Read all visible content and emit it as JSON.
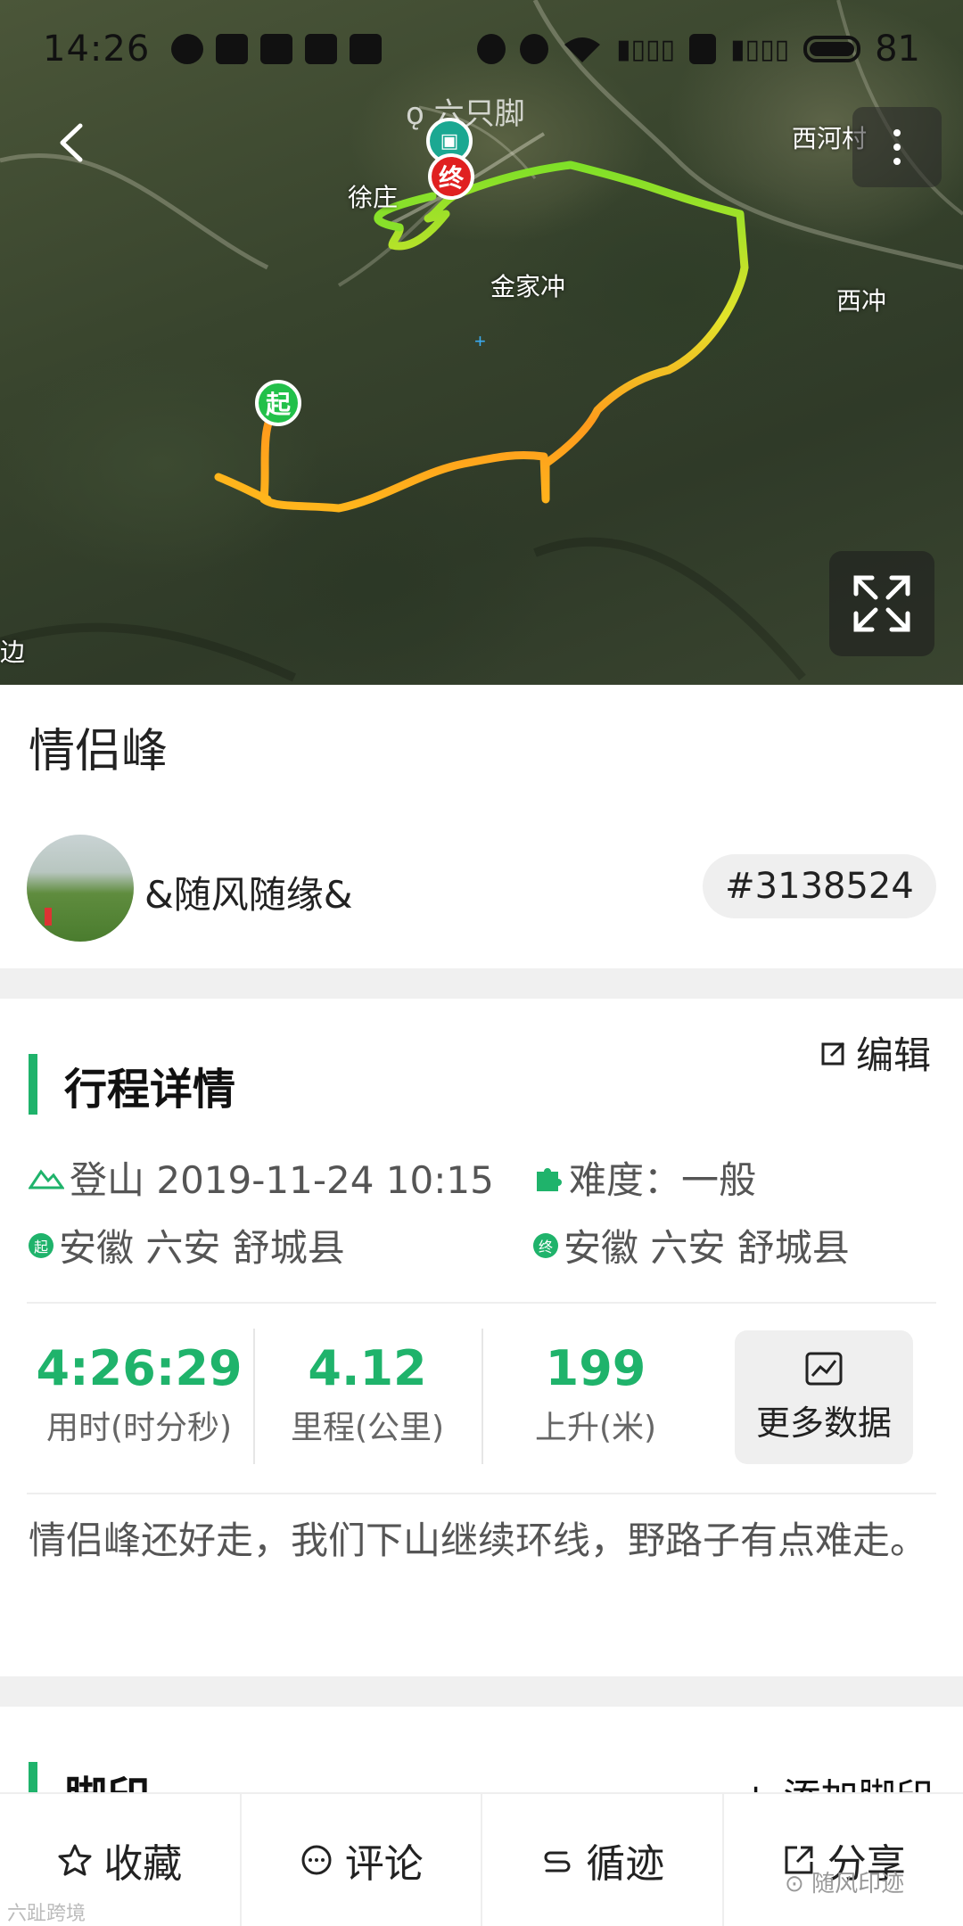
{
  "status_bar": {
    "time": "14:26",
    "battery": "81"
  },
  "map": {
    "watermark": "六只脚",
    "places": [
      "徐庄",
      "西河村",
      "金家冲",
      "西冲",
      "边"
    ],
    "start_pin": "起",
    "end_pin": "终",
    "icons": {
      "back": "back-arrow-icon",
      "more": "more-vertical-icon",
      "expand": "expand-icon",
      "photo": "photo-icon"
    }
  },
  "trip": {
    "title": "情侣峰",
    "author": "&随风随缘&",
    "id_tag": "#3138524"
  },
  "details": {
    "section_title": "行程详情",
    "edit_label": "编辑",
    "activity": "登山 2019-11-24 10:15",
    "difficulty": "难度：一般",
    "start_badge": "起",
    "start_location": "安徽 六安 舒城县",
    "end_badge": "终",
    "end_location": "安徽 六安 舒城县",
    "stats": [
      {
        "value": "4:26:29",
        "label": "用时(时分秒)"
      },
      {
        "value": "4.12",
        "label": "里程(公里)"
      },
      {
        "value": "199",
        "label": "上升(米)"
      }
    ],
    "more_data_label": "更多数据",
    "description": "情侣峰还好走，我们下山继续环线，野路子有点难走。"
  },
  "footprints": {
    "section_title": "脚印",
    "add_label": "+ 添加脚印"
  },
  "tabbar": [
    {
      "label": "收藏",
      "icon": "star-icon"
    },
    {
      "label": "评论",
      "icon": "comment-icon"
    },
    {
      "label": "循迹",
      "icon": "follow-track-icon"
    },
    {
      "label": "分享",
      "icon": "share-icon"
    }
  ],
  "watermarks": {
    "bottom_right": "随风印迹",
    "bottom_left": "六趾跨境"
  },
  "colors": {
    "accent": "#1fb36b",
    "end_pin": "#e02020",
    "start_pin": "#22c04a"
  }
}
